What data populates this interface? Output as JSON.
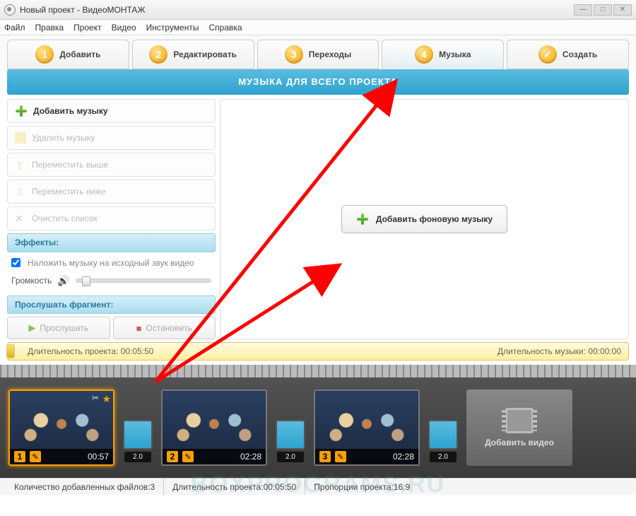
{
  "window": {
    "title": "Новый проект - ВидеоМОНТАЖ"
  },
  "menu": {
    "file": "Файл",
    "edit": "Правка",
    "project": "Проект",
    "video": "Видео",
    "tools": "Инструменты",
    "help": "Справка"
  },
  "steps": {
    "s1": "Добавить",
    "s2": "Редактировать",
    "s3": "Переходы",
    "s4": "Музыка",
    "s5": "Создать"
  },
  "banner": "МУЗЫКА ДЛЯ ВСЕГО ПРОЕКТА",
  "sidebar": {
    "add_music": "Добавить музыку",
    "delete_music": "Удалить музыку",
    "move_up": "Переместить выше",
    "move_down": "Переместить ниже",
    "clear_list": "Очистить список",
    "effects_header": "Эффекты:",
    "overlay_chk": "Наложить музыку на исходный звук видео",
    "volume_label": "Громкость",
    "preview_header": "Прослушать фрагмент:",
    "play": "Прослушать",
    "stop": "Остановить"
  },
  "main": {
    "add_bg_music": "Добавить фоновую музыку"
  },
  "duration": {
    "project_label": "Длительность проекта: ",
    "project_value": "00:05:50",
    "music_label": "Длительность музыки: ",
    "music_value": "00:00:00"
  },
  "timeline": {
    "clips": [
      {
        "num": "1",
        "time": "00:57"
      },
      {
        "num": "2",
        "time": "02:28"
      },
      {
        "num": "3",
        "time": "02:28"
      }
    ],
    "transition_duration": "2.0",
    "add_video": "Добавить видео"
  },
  "status": {
    "files_label": "Количество добавленных файлов: ",
    "files_value": "3",
    "duration_label": "Длительность проекта: ",
    "duration_value": "00:05:50",
    "aspect_label": "Пропорции проекта: ",
    "aspect_value": "16:9"
  },
  "watermark": "BOXPROGRAMS.RU"
}
